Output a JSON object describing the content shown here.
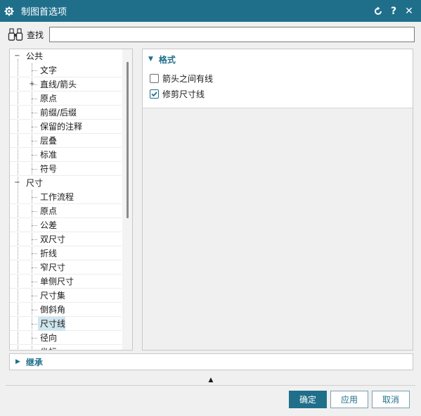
{
  "window": {
    "title": "制图首选项",
    "reset_icon": "reset-icon",
    "help_label": "?",
    "close_label": "✕"
  },
  "search": {
    "label": "查找",
    "value": ""
  },
  "tree": {
    "groups": [
      {
        "label": "公共",
        "expanded": true,
        "children": [
          "文字",
          "直线/箭头",
          "原点",
          "前缀/后缀",
          "保留的注释",
          "层叠",
          "标准",
          "符号"
        ]
      },
      {
        "label": "尺寸",
        "expanded": true,
        "children": [
          "工作流程",
          "原点",
          "公差",
          "双尺寸",
          "折线",
          "窄尺寸",
          "单侧尺寸",
          "尺寸集",
          "倒斜角",
          "尺寸线",
          "径向",
          "坐标"
        ]
      }
    ],
    "collapsed_child": "直线/箭头",
    "selected": "尺寸线"
  },
  "format_group": {
    "header": "格式",
    "options": [
      {
        "label": "箭头之间有线",
        "checked": false
      },
      {
        "label": "修剪尺寸线",
        "checked": true
      }
    ]
  },
  "inherit": {
    "label": "继承"
  },
  "buttons": {
    "ok": "确定",
    "apply": "应用",
    "cancel": "取消"
  },
  "colors": {
    "accent": "#1f6f8b",
    "selection": "#cfe6ee"
  }
}
